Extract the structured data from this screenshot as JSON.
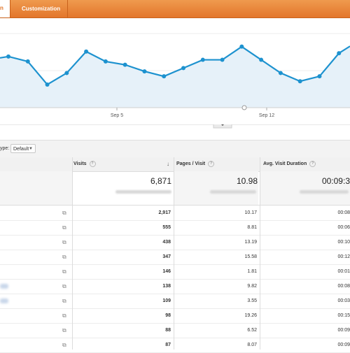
{
  "tabs": {
    "active_label": "n",
    "customization": "Customization"
  },
  "chart_data": {
    "type": "line",
    "x_ticks": [
      "Sep 5",
      "Sep 12"
    ],
    "series": [
      {
        "values": [
          0.62,
          0.56,
          0.28,
          0.42,
          0.68,
          0.56,
          0.52,
          0.44,
          0.38,
          0.48,
          0.58,
          0.58,
          0.74,
          0.58,
          0.42,
          0.32,
          0.38,
          0.66
        ]
      }
    ],
    "color": "#1d92cf"
  },
  "toolbar": {
    "label": "ype:",
    "dropdown_value": "Default"
  },
  "table": {
    "columns": {
      "visits": "Visits",
      "pages": "Pages / Visit",
      "duration": "Avg. Visit Duration"
    },
    "totals": {
      "visits": "6,871",
      "pages": "10.98",
      "duration": "00:09:3"
    },
    "rows": [
      {
        "visits": "2,917",
        "pages": "10.17",
        "duration": "00:08",
        "blur": false
      },
      {
        "visits": "555",
        "pages": "8.81",
        "duration": "00:06",
        "blur": false
      },
      {
        "visits": "438",
        "pages": "13.19",
        "duration": "00:10",
        "blur": false
      },
      {
        "visits": "347",
        "pages": "15.58",
        "duration": "00:12",
        "blur": false
      },
      {
        "visits": "146",
        "pages": "1.81",
        "duration": "00:01",
        "blur": false
      },
      {
        "visits": "138",
        "pages": "9.82",
        "duration": "00:08",
        "blur": true
      },
      {
        "visits": "109",
        "pages": "3.55",
        "duration": "00:03",
        "blur": true
      },
      {
        "visits": "98",
        "pages": "19.26",
        "duration": "00:15",
        "blur": false
      },
      {
        "visits": "88",
        "pages": "6.52",
        "duration": "00:09",
        "blur": false
      },
      {
        "visits": "87",
        "pages": "8.07",
        "duration": "00:09",
        "blur": false
      }
    ]
  }
}
